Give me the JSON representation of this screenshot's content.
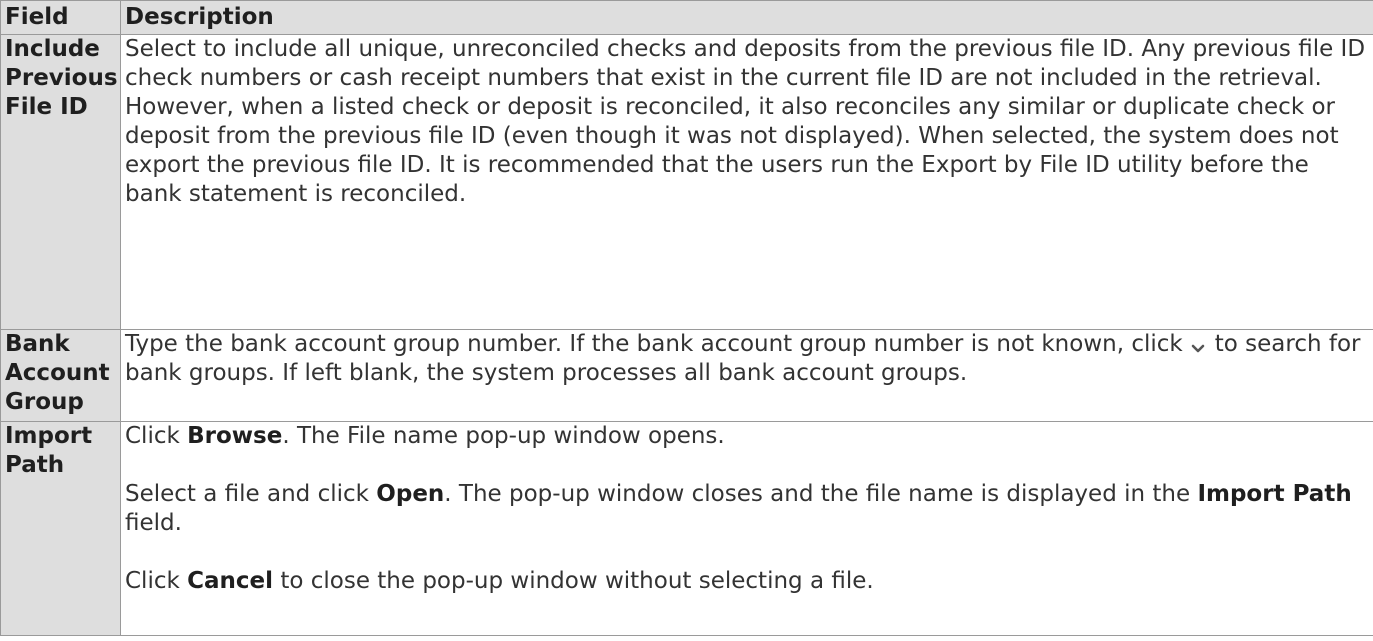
{
  "headers": {
    "field": "Field",
    "description": "Description"
  },
  "rows": [
    {
      "field": "Include Previous File ID",
      "description": "Select to include all unique, unreconciled checks and deposits from the previous file ID. Any previous file ID check numbers or cash receipt numbers that exist in the current file ID are not included in the retrieval. However, when a listed check or deposit is reconciled, it also reconciles any similar or duplicate check or deposit from the previous file ID (even though it was not displayed). When selected, the system does not export the previous file ID. It is recommended that the users run the Export by File ID utility before the bank statement is reconciled."
    },
    {
      "field": "Bank Account Group",
      "desc_before_icon": "Type the bank account group number. If the bank account group number is not known, click",
      "icon": "chevron-down-icon",
      "desc_after_icon": "to search for bank groups. If left blank, the system processes all bank account groups."
    },
    {
      "field": "Import Path",
      "p1_a": "Click ",
      "p1_b": "Browse",
      "p1_c": ". The File name pop-up window opens.",
      "p2_a": "Select a file and click ",
      "p2_b": "Open",
      "p2_c": ". The pop-up window closes and the file name is displayed in the ",
      "p2_d": "Import Path",
      "p2_e": " field.",
      "p3_a": "Click ",
      "p3_b": "Cancel",
      "p3_c": " to close the pop-up window without selecting a file."
    }
  ],
  "colors": {
    "header_bg": "#dedede",
    "border": "#9a9a9a",
    "text": "#333333"
  }
}
